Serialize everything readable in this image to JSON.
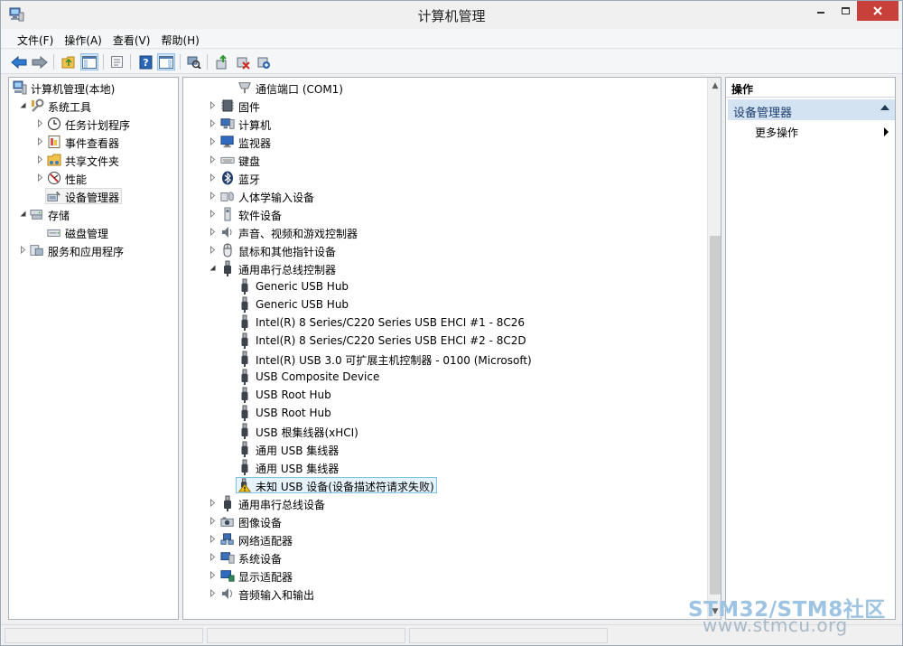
{
  "window": {
    "title": "计算机管理",
    "controls": {
      "minimize": "minimize-icon",
      "maximize": "maximize-icon",
      "close": "close-icon"
    }
  },
  "menu": [
    "文件(F)",
    "操作(A)",
    "查看(V)",
    "帮助(H)"
  ],
  "toolbar": [
    "back-arrow-icon",
    "forward-arrow-icon",
    "up-folder-icon",
    "show-tree-icon",
    "properties-icon",
    "help-icon",
    "action-pane-icon",
    "scan-hardware-icon",
    "update-driver-icon",
    "disable-device-icon",
    "uninstall-device-icon"
  ],
  "tree": [
    {
      "label": "计算机管理(本地)",
      "level": 0,
      "state": "none",
      "icon": "computer-management-icon"
    },
    {
      "label": "系统工具",
      "level": 1,
      "state": "open",
      "icon": "system-tools-icon"
    },
    {
      "label": "任务计划程序",
      "level": 2,
      "state": "closed",
      "icon": "task-scheduler-icon"
    },
    {
      "label": "事件查看器",
      "level": 2,
      "state": "closed",
      "icon": "event-viewer-icon"
    },
    {
      "label": "共享文件夹",
      "level": 2,
      "state": "closed",
      "icon": "shared-folder-icon"
    },
    {
      "label": "性能",
      "level": 2,
      "state": "closed",
      "icon": "performance-icon"
    },
    {
      "label": "设备管理器",
      "level": 2,
      "state": "none",
      "icon": "device-manager-icon",
      "selected": true
    },
    {
      "label": "存储",
      "level": 1,
      "state": "open",
      "icon": "storage-icon"
    },
    {
      "label": "磁盘管理",
      "level": 2,
      "state": "none",
      "icon": "disk-management-icon"
    },
    {
      "label": "服务和应用程序",
      "level": 1,
      "state": "closed",
      "icon": "services-apps-icon"
    }
  ],
  "devices": [
    {
      "label": "通信端口 (COM1)",
      "level": 1,
      "state": "none",
      "icon": "com-port-icon"
    },
    {
      "label": "固件",
      "level": 0,
      "state": "closed",
      "icon": "firmware-icon"
    },
    {
      "label": "计算机",
      "level": 0,
      "state": "closed",
      "icon": "computer-icon"
    },
    {
      "label": "监视器",
      "level": 0,
      "state": "closed",
      "icon": "monitor-icon"
    },
    {
      "label": "键盘",
      "level": 0,
      "state": "closed",
      "icon": "keyboard-icon"
    },
    {
      "label": "蓝牙",
      "level": 0,
      "state": "closed",
      "icon": "bluetooth-icon"
    },
    {
      "label": "人体学输入设备",
      "level": 0,
      "state": "closed",
      "icon": "hid-icon"
    },
    {
      "label": "软件设备",
      "level": 0,
      "state": "closed",
      "icon": "software-device-icon"
    },
    {
      "label": "声音、视频和游戏控制器",
      "level": 0,
      "state": "closed",
      "icon": "sound-icon"
    },
    {
      "label": "鼠标和其他指针设备",
      "level": 0,
      "state": "closed",
      "icon": "mouse-icon"
    },
    {
      "label": "通用串行总线控制器",
      "level": 0,
      "state": "open",
      "icon": "usb-controller-icon"
    },
    {
      "label": "Generic USB Hub",
      "level": 1,
      "state": "none",
      "icon": "usb-device-icon"
    },
    {
      "label": "Generic USB Hub",
      "level": 1,
      "state": "none",
      "icon": "usb-device-icon"
    },
    {
      "label": "Intel(R) 8 Series/C220 Series USB EHCI #1 - 8C26",
      "level": 1,
      "state": "none",
      "icon": "usb-device-icon"
    },
    {
      "label": "Intel(R) 8 Series/C220 Series USB EHCI #2 - 8C2D",
      "level": 1,
      "state": "none",
      "icon": "usb-device-icon"
    },
    {
      "label": "Intel(R) USB 3.0 可扩展主机控制器 - 0100 (Microsoft)",
      "level": 1,
      "state": "none",
      "icon": "usb-device-icon"
    },
    {
      "label": "USB Composite Device",
      "level": 1,
      "state": "none",
      "icon": "usb-device-icon"
    },
    {
      "label": "USB Root Hub",
      "level": 1,
      "state": "none",
      "icon": "usb-device-icon"
    },
    {
      "label": "USB Root Hub",
      "level": 1,
      "state": "none",
      "icon": "usb-device-icon"
    },
    {
      "label": "USB 根集线器(xHCI)",
      "level": 1,
      "state": "none",
      "icon": "usb-device-icon"
    },
    {
      "label": "通用 USB 集线器",
      "level": 1,
      "state": "none",
      "icon": "usb-device-icon"
    },
    {
      "label": "通用 USB 集线器",
      "level": 1,
      "state": "none",
      "icon": "usb-device-icon"
    },
    {
      "label": "未知 USB 设备(设备描述符请求失败)",
      "level": 1,
      "state": "none",
      "icon": "warning-usb-icon",
      "selected": true
    },
    {
      "label": "通用串行总线设备",
      "level": 0,
      "state": "closed",
      "icon": "usb-controller-icon"
    },
    {
      "label": "图像设备",
      "level": 0,
      "state": "closed",
      "icon": "imaging-icon"
    },
    {
      "label": "网络适配器",
      "level": 0,
      "state": "closed",
      "icon": "network-icon"
    },
    {
      "label": "系统设备",
      "level": 0,
      "state": "closed",
      "icon": "system-device-icon"
    },
    {
      "label": "显示适配器",
      "level": 0,
      "state": "closed",
      "icon": "display-adapter-icon"
    },
    {
      "label": "音频输入和输出",
      "level": 0,
      "state": "closed",
      "icon": "audio-io-icon"
    }
  ],
  "actions": {
    "header": "操作",
    "section": "设备管理器",
    "more": "更多操作"
  },
  "watermark": {
    "line1": "STM32/STM8社区",
    "line2": "www.stmcu.org"
  }
}
